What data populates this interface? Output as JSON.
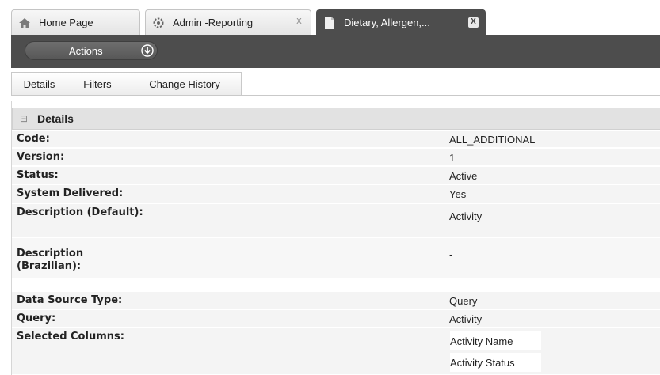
{
  "tabs": [
    {
      "label": "Home Page",
      "icon": "home-icon"
    },
    {
      "label": "Admin -Reporting",
      "icon": "gear-icon",
      "close": "X"
    },
    {
      "label": "Dietary, Allergen,...",
      "icon": "document-icon",
      "close": "X"
    }
  ],
  "toolbar": {
    "actions_label": "Actions",
    "actions_icon": "download-arrow-icon"
  },
  "subtabs": [
    "Details",
    "Filters",
    "Change History"
  ],
  "details": {
    "header": "Details",
    "rows": [
      {
        "label": "Code:",
        "value": "ALL_ADDITIONAL"
      },
      {
        "label": "Version:",
        "value": "1"
      },
      {
        "label": "Status:",
        "value": "Active"
      },
      {
        "label": "System Delivered:",
        "value": "Yes"
      },
      {
        "label": "Description (Default):",
        "value": "Activity"
      },
      {
        "label": "Description (Brazilian):",
        "value": "-"
      },
      {
        "label": "Data Source Type:",
        "value": "Query"
      },
      {
        "label": "Query:",
        "value": "Activity"
      },
      {
        "label": "Selected Columns:",
        "values": [
          "Activity Name",
          "Activity Status"
        ]
      }
    ]
  },
  "colors": {
    "dark_bar": "#4d4d4d",
    "row_shade": "#f4f4f4",
    "header_bg": "#e2e2e2"
  }
}
